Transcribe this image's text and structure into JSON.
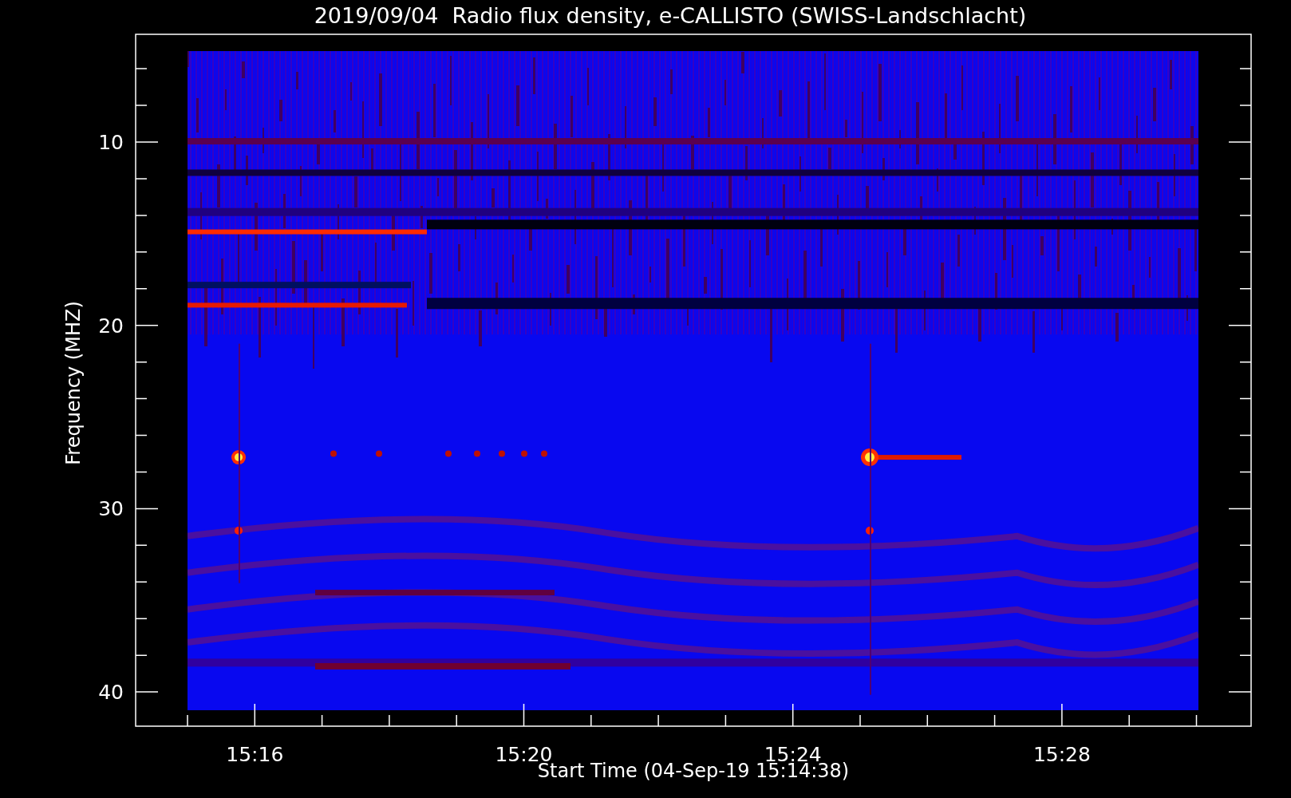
{
  "title": "2019/09/04  Radio flux density, e-CALLISTO (SWISS-Landschlacht)",
  "ylabel": "Frequency (MHZ)",
  "yticks": [
    "10",
    "20",
    "30",
    "40"
  ],
  "xticks": [
    "15:16",
    "15:20",
    "15:24",
    "15:28"
  ],
  "xlabel": "Start Time (04-Sep-19 15:14:38)"
}
